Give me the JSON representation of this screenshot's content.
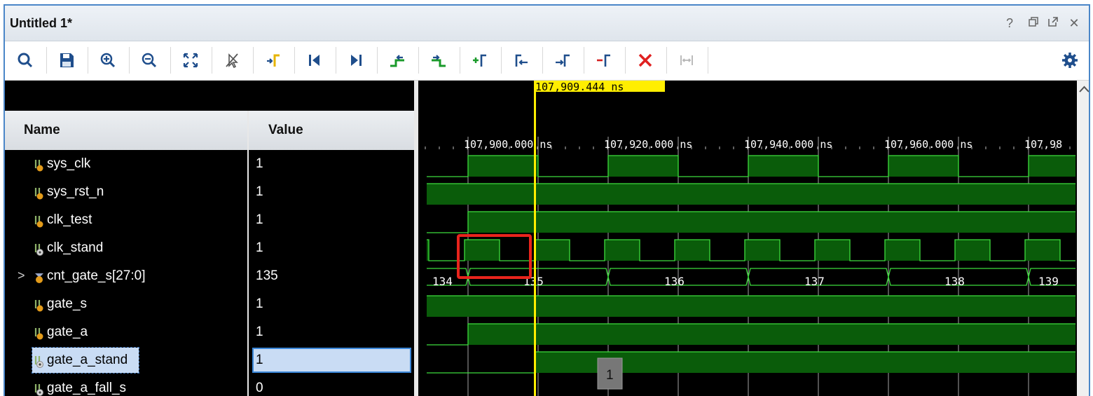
{
  "window": {
    "title": "Untitled 1*"
  },
  "window_controls": {
    "help": "?",
    "restore": "🗗",
    "float": "⇱",
    "close": "✕"
  },
  "toolbar": {
    "items": [
      {
        "name": "search-button",
        "icon": "magnifier-icon"
      },
      {
        "name": "save-button",
        "icon": "floppy-icon"
      },
      {
        "name": "zoom-in-button",
        "icon": "zoom-in-icon"
      },
      {
        "name": "zoom-out-button",
        "icon": "zoom-out-icon"
      },
      {
        "name": "zoom-fit-button",
        "icon": "zoom-fit-icon"
      },
      {
        "name": "cursor-off-button",
        "icon": "cursor-strike-icon"
      },
      {
        "name": "goto-cursor-button",
        "icon": "goto-cursor-icon"
      },
      {
        "name": "goto-start-button",
        "icon": "skip-start-icon"
      },
      {
        "name": "goto-end-button",
        "icon": "skip-end-icon"
      },
      {
        "name": "prev-transition-button",
        "icon": "prev-transition-icon"
      },
      {
        "name": "next-transition-button",
        "icon": "next-transition-icon"
      },
      {
        "name": "add-marker-button",
        "icon": "add-marker-icon"
      },
      {
        "name": "prev-marker-button",
        "icon": "prev-marker-icon"
      },
      {
        "name": "next-marker-button",
        "icon": "next-marker-icon"
      },
      {
        "name": "delete-marker-button",
        "icon": "remove-marker-icon"
      },
      {
        "name": "delete-all-markers-button",
        "icon": "red-x-icon"
      },
      {
        "name": "swap-cursors-button",
        "icon": "swap-cursors-icon"
      }
    ],
    "settings_icon": "gear-icon"
  },
  "columns": {
    "name": "Name",
    "value": "Value"
  },
  "signals": [
    {
      "name": "sys_clk",
      "value": "1",
      "kind": "bit"
    },
    {
      "name": "sys_rst_n",
      "value": "1",
      "kind": "bit"
    },
    {
      "name": "clk_test",
      "value": "1",
      "kind": "bit"
    },
    {
      "name": "clk_stand",
      "value": "1",
      "kind": "bit-internal"
    },
    {
      "name": "cnt_gate_s[27:0]",
      "value": "135",
      "kind": "bus",
      "expander": ">"
    },
    {
      "name": "gate_s",
      "value": "1",
      "kind": "bit"
    },
    {
      "name": "gate_a",
      "value": "1",
      "kind": "bit"
    },
    {
      "name": "gate_a_stand",
      "value": "1",
      "kind": "bit-internal",
      "selected": true
    },
    {
      "name": "gate_a_fall_s",
      "value": "0",
      "kind": "bit-internal"
    }
  ],
  "waveform": {
    "cursor_time": "107,909.444 ns",
    "time_ticks": [
      "107,900.000 ns",
      "107,920.000 ns",
      "107,940.000 ns",
      "107,960.000 ns",
      "107,98"
    ],
    "bus_values": [
      "134",
      "135",
      "136",
      "137",
      "138",
      "139"
    ],
    "hover_value": "1",
    "colors": {
      "wave": "#3ddc3d",
      "wave_fill": "#0a5c0a",
      "cursor": "#ffee00",
      "highlight_box": "#e8241c",
      "grid": "#cfcfcf"
    }
  }
}
